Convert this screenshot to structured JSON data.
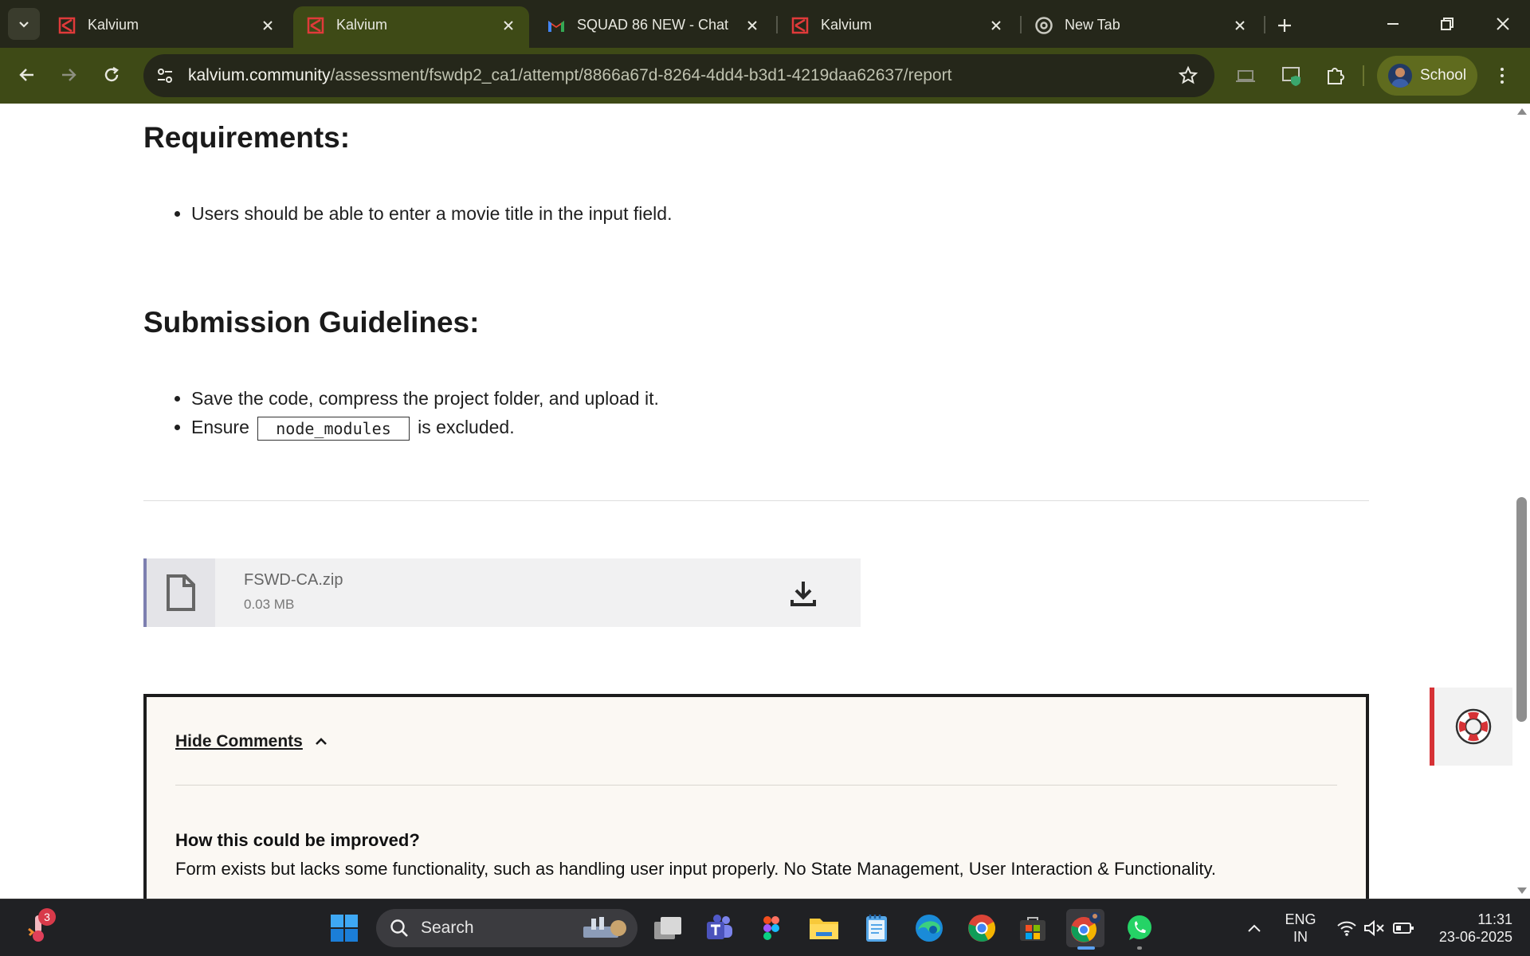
{
  "browser": {
    "tabs": [
      {
        "title": "Kalvium",
        "favicon": "kalvium-icon",
        "active": false
      },
      {
        "title": "Kalvium",
        "favicon": "kalvium-icon",
        "active": true
      },
      {
        "title": "SQUAD 86 NEW - Chat",
        "favicon": "gmail-icon",
        "active": false
      },
      {
        "title": "Kalvium",
        "favicon": "kalvium-icon",
        "active": false
      },
      {
        "title": "New Tab",
        "favicon": "chrome-icon",
        "active": false
      }
    ],
    "url_host": "kalvium.community",
    "url_path": "/assessment/fswdp2_ca1/attempt/8866a67d-8264-4dd4-b3d1-4219daa62637/report",
    "profile_name": "School",
    "colors": {
      "frame": "#25271a",
      "toolbar": "#3e4a16",
      "profile_chip": "#5f6b1e"
    }
  },
  "content": {
    "requirements_heading": "Requirements:",
    "requirements": [
      "Users should be able to enter a movie title in the input field."
    ],
    "submission_heading": "Submission Guidelines:",
    "submission_item_1": "Save the code, compress the project folder, and upload it.",
    "submission_item_2_prefix": "Ensure",
    "submission_item_2_code": "node_modules",
    "submission_item_2_suffix": "is excluded.",
    "file": {
      "name": "FSWD-CA.zip",
      "size": "0.03 MB"
    },
    "comments": {
      "toggle_label": "Hide Comments",
      "question": "How this could be improved?",
      "answer": "Form exists but lacks some functionality, such as handling user input properly. No State Management, User Interaction & Functionality."
    }
  },
  "taskbar": {
    "search_label": "Search",
    "notification_count": "3",
    "language_line1": "ENG",
    "language_line2": "IN",
    "time": "11:31",
    "date": "23-06-2025"
  }
}
